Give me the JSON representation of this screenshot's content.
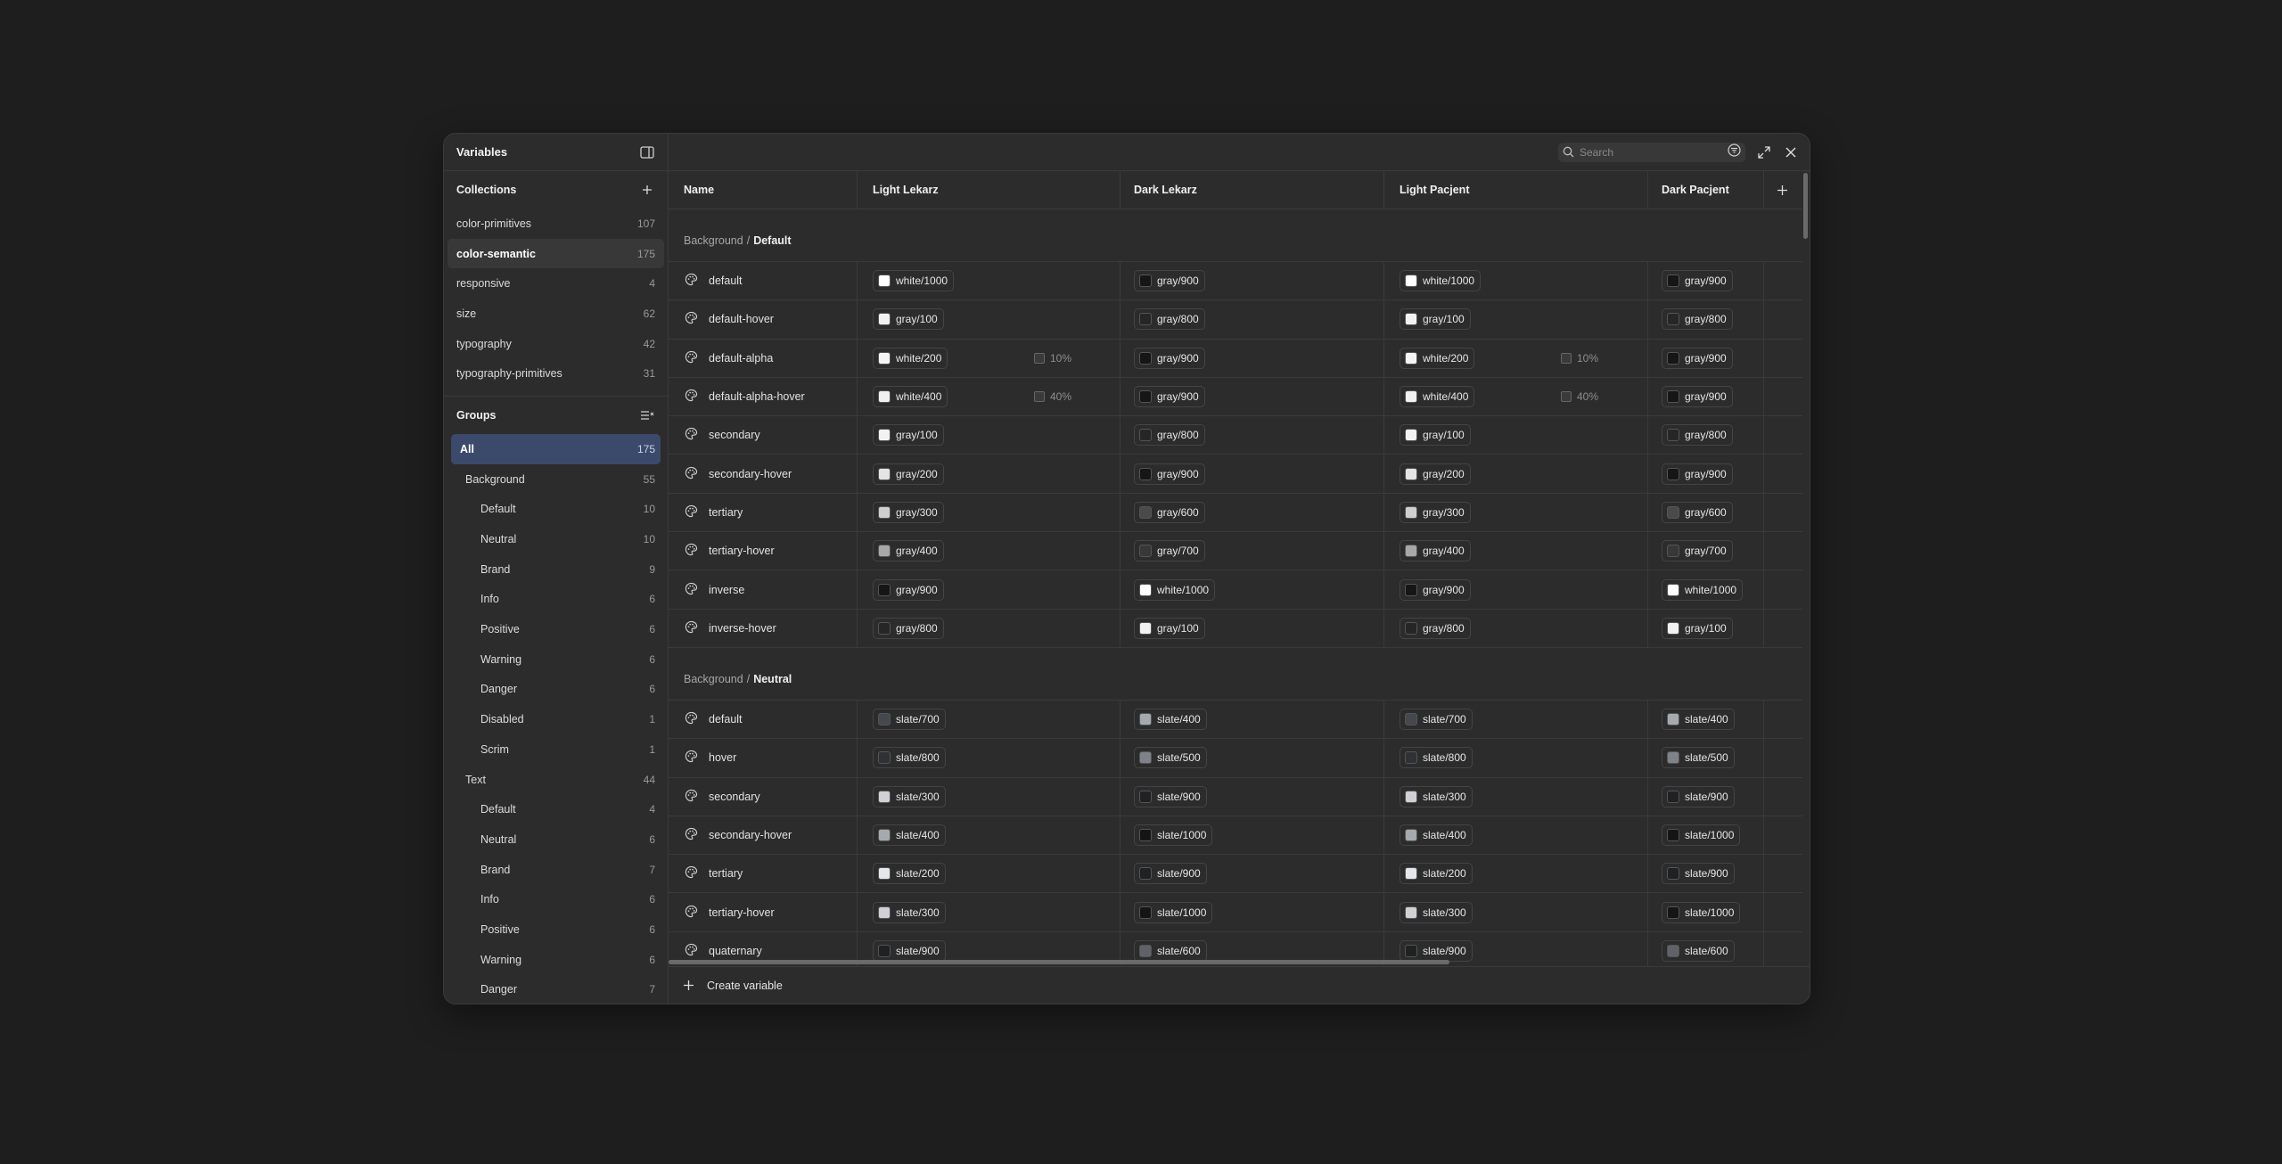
{
  "sidebar": {
    "title": "Variables",
    "collections_title": "Collections",
    "collections": [
      {
        "label": "color-primitives",
        "count": "107"
      },
      {
        "label": "color-semantic",
        "count": "175"
      },
      {
        "label": "responsive",
        "count": "4"
      },
      {
        "label": "size",
        "count": "62"
      },
      {
        "label": "typography",
        "count": "42"
      },
      {
        "label": "typography-primitives",
        "count": "31"
      }
    ],
    "groups_title": "Groups",
    "groups": [
      {
        "label": "All",
        "count": "175"
      },
      {
        "label": "Background",
        "count": "55"
      },
      {
        "label": "Default",
        "count": "10"
      },
      {
        "label": "Neutral",
        "count": "10"
      },
      {
        "label": "Brand",
        "count": "9"
      },
      {
        "label": "Info",
        "count": "6"
      },
      {
        "label": "Positive",
        "count": "6"
      },
      {
        "label": "Warning",
        "count": "6"
      },
      {
        "label": "Danger",
        "count": "6"
      },
      {
        "label": "Disabled",
        "count": "1"
      },
      {
        "label": "Scrim",
        "count": "1"
      },
      {
        "label": "Text",
        "count": "44"
      },
      {
        "label": "Default",
        "count": "4"
      },
      {
        "label": "Neutral",
        "count": "6"
      },
      {
        "label": "Brand",
        "count": "7"
      },
      {
        "label": "Info",
        "count": "6"
      },
      {
        "label": "Positive",
        "count": "6"
      },
      {
        "label": "Warning",
        "count": "6"
      },
      {
        "label": "Danger",
        "count": "7"
      }
    ]
  },
  "search": {
    "placeholder": "Search"
  },
  "columns": [
    "Name",
    "Light Lekarz",
    "Dark Lekarz",
    "Light Pacjent",
    "Dark Pacjent"
  ],
  "groups": [
    {
      "prefix": "Background",
      "sep": "/",
      "name": "Default",
      "rows": [
        {
          "name": "default",
          "c1": "white/1000",
          "c2": "gray/900",
          "c3": "white/1000",
          "c4": "gray/900"
        },
        {
          "name": "default-hover",
          "c1": "gray/100",
          "c2": "gray/800",
          "c3": "gray/100",
          "c4": "gray/800"
        },
        {
          "name": "default-alpha",
          "c1": "white/200",
          "a1": "10%",
          "c2": "gray/900",
          "c3": "white/200",
          "a3": "10%",
          "c4": "gray/900"
        },
        {
          "name": "default-alpha-hover",
          "c1": "white/400",
          "a1": "40%",
          "c2": "gray/900",
          "c3": "white/400",
          "a3": "40%",
          "c4": "gray/900"
        },
        {
          "name": "secondary",
          "c1": "gray/100",
          "c2": "gray/800",
          "c3": "gray/100",
          "c4": "gray/800"
        },
        {
          "name": "secondary-hover",
          "c1": "gray/200",
          "c2": "gray/900",
          "c3": "gray/200",
          "c4": "gray/900"
        },
        {
          "name": "tertiary",
          "c1": "gray/300",
          "c2": "gray/600",
          "c3": "gray/300",
          "c4": "gray/600"
        },
        {
          "name": "tertiary-hover",
          "c1": "gray/400",
          "c2": "gray/700",
          "c3": "gray/400",
          "c4": "gray/700"
        },
        {
          "name": "inverse",
          "c1": "gray/900",
          "c2": "white/1000",
          "c3": "gray/900",
          "c4": "white/1000"
        },
        {
          "name": "inverse-hover",
          "c1": "gray/800",
          "c2": "gray/100",
          "c3": "gray/800",
          "c4": "gray/100"
        }
      ]
    },
    {
      "prefix": "Background",
      "sep": "/",
      "name": "Neutral",
      "rows": [
        {
          "name": "default",
          "c1": "slate/700",
          "c2": "slate/400",
          "c3": "slate/700",
          "c4": "slate/400"
        },
        {
          "name": "hover",
          "c1": "slate/800",
          "c2": "slate/500",
          "c3": "slate/800",
          "c4": "slate/500"
        },
        {
          "name": "secondary",
          "c1": "slate/300",
          "c2": "slate/900",
          "c3": "slate/300",
          "c4": "slate/900"
        },
        {
          "name": "secondary-hover",
          "c1": "slate/400",
          "c2": "slate/1000",
          "c3": "slate/400",
          "c4": "slate/1000"
        },
        {
          "name": "tertiary",
          "c1": "slate/200",
          "c2": "slate/900",
          "c3": "slate/200",
          "c4": "slate/900"
        },
        {
          "name": "tertiary-hover",
          "c1": "slate/300",
          "c2": "slate/1000",
          "c3": "slate/300",
          "c4": "slate/1000"
        },
        {
          "name": "quaternary",
          "c1": "slate/900",
          "c2": "slate/600",
          "c3": "slate/900",
          "c4": "slate/600"
        }
      ]
    }
  ],
  "swatch_colors": {
    "white/1000": "#ffffff",
    "white/200": "#f4f4f4",
    "white/400": "#f1f1f1",
    "gray/100": "#f2f2f2",
    "gray/200": "#e4e4e4",
    "gray/300": "#cfcfcf",
    "gray/400": "#a8a8a8",
    "gray/600": "#4a4a4a",
    "gray/700": "#383838",
    "gray/800": "#262626",
    "gray/900": "#161616",
    "slate/200": "#e6e7ea",
    "slate/300": "#cfd1d5",
    "slate/400": "#a6a9ae",
    "slate/500": "#7f8389",
    "slate/600": "#5f6368",
    "slate/700": "#45484c",
    "slate/800": "#2f3134",
    "slate/900": "#1f2123",
    "slate/1000": "#141516"
  },
  "footer": {
    "create_label": "Create variable"
  }
}
